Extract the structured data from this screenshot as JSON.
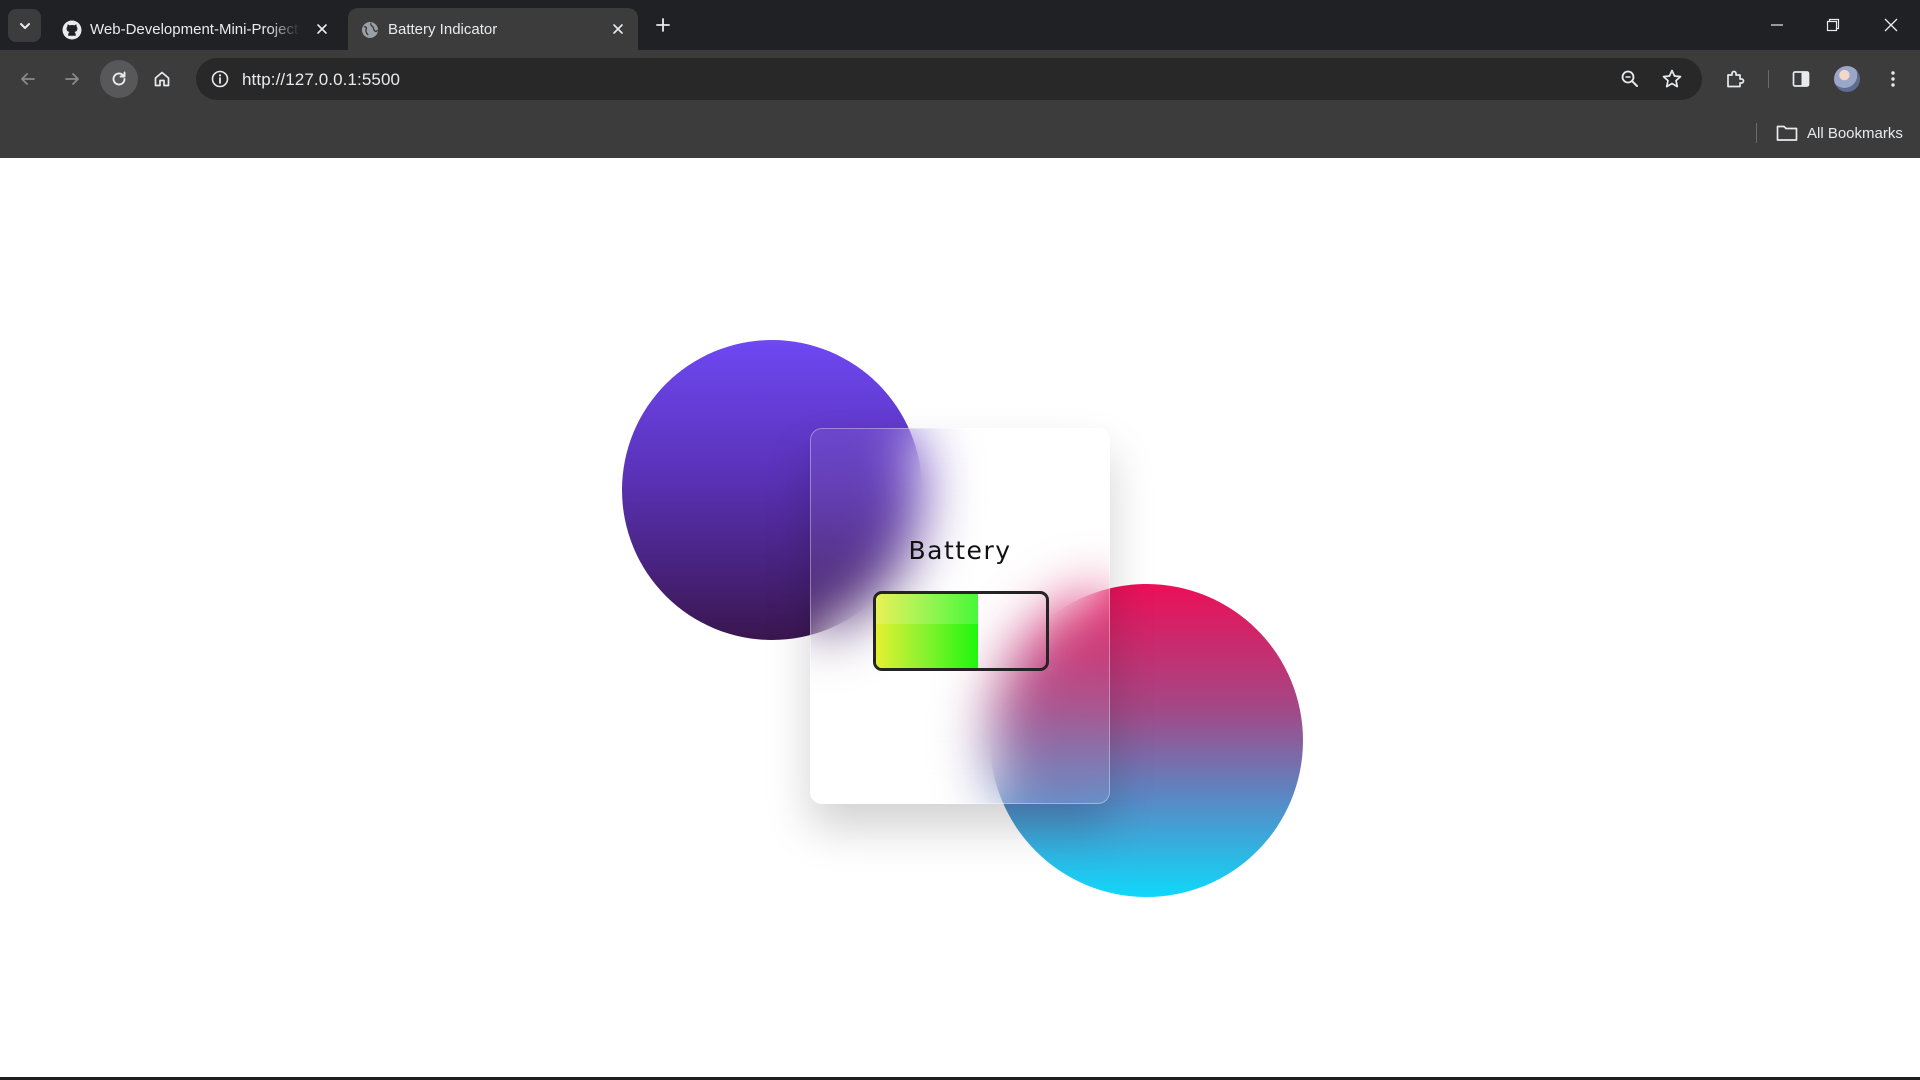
{
  "browser": {
    "tabs": [
      {
        "title": "Web-Development-Mini-Projects",
        "favicon": "github-icon",
        "active": false
      },
      {
        "title": "Battery Indicator",
        "favicon": "globe-icon",
        "active": true
      }
    ],
    "address_bar": {
      "url": "http://127.0.0.1:5500"
    },
    "bookmarks_bar": {
      "all_bookmarks_label": "All Bookmarks"
    }
  },
  "page": {
    "card_title": "Battery",
    "battery_level": 0.6,
    "colors": {
      "fill_start": "#e3f02f",
      "fill_end": "#1ef70d",
      "circle_top_start": "#6e48f2",
      "circle_top_end": "#3a164f",
      "circle_bottom_start": "#ec0f57",
      "circle_bottom_end": "#0fd8fa"
    }
  }
}
